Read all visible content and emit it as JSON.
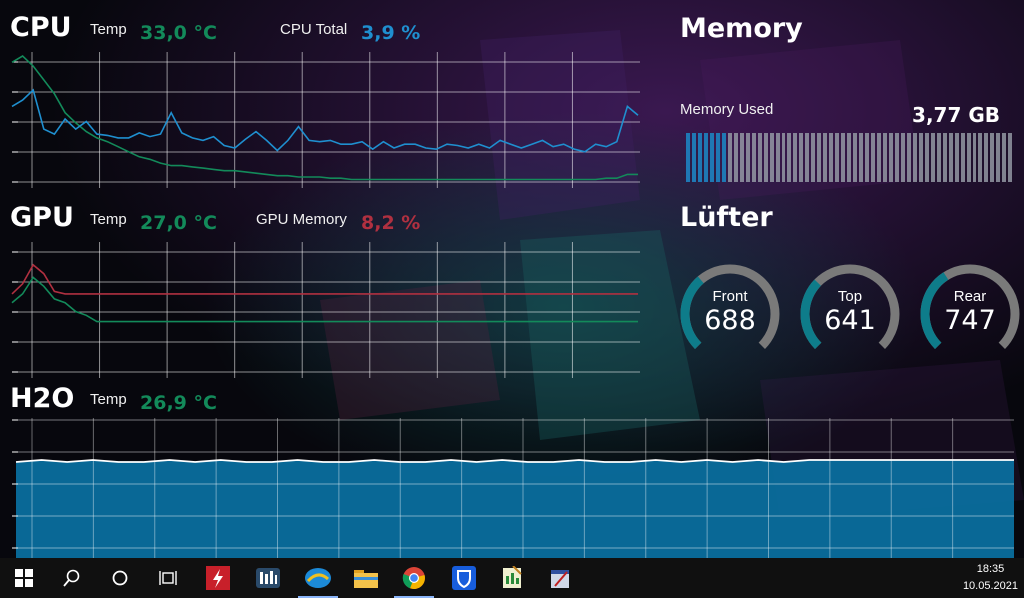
{
  "cpu": {
    "title": "CPU",
    "temp_label": "Temp",
    "temp_value": "33,0 °C",
    "total_label": "CPU Total",
    "total_value": "3,9 %",
    "colors": {
      "temp": "#138a5a",
      "total": "#1f8fcf"
    },
    "chart_data": {
      "type": "line",
      "series": [
        {
          "values": [
            95,
            100,
            92,
            81,
            70,
            55,
            47,
            40,
            35,
            32,
            28,
            24,
            20,
            18,
            15,
            13,
            13,
            12,
            11,
            10,
            9,
            9,
            8,
            7,
            6,
            5,
            5,
            4,
            4,
            4,
            3,
            3,
            2,
            2,
            2,
            2,
            2,
            2,
            2,
            2,
            2,
            2,
            2,
            2,
            2,
            2,
            2,
            2,
            2,
            2,
            2,
            2,
            2,
            2,
            2,
            2,
            3,
            3,
            6,
            6
          ]
        },
        {
          "values": [
            60,
            65,
            73,
            42,
            38,
            50,
            42,
            48,
            38,
            37,
            35,
            35,
            39,
            36,
            38,
            55,
            39,
            35,
            33,
            36,
            29,
            27,
            34,
            40,
            33,
            25,
            33,
            44,
            33,
            32,
            33,
            30,
            30,
            32,
            26,
            32,
            27,
            30,
            30,
            27,
            26,
            30,
            29,
            27,
            30,
            27,
            33,
            30,
            27,
            30,
            33,
            28,
            30,
            26,
            24,
            30,
            28,
            32,
            60,
            53
          ]
        }
      ],
      "ylim": [
        0,
        100
      ],
      "grid": true
    }
  },
  "gpu": {
    "title": "GPU",
    "temp_label": "Temp",
    "temp_value": "27,0 °C",
    "mem_label": "GPU Memory",
    "mem_value": "8,2 %",
    "colors": {
      "temp": "#138a5a",
      "mem": "#b03040"
    },
    "chart_data": {
      "type": "line",
      "series": [
        {
          "values": [
            55,
            62,
            75,
            68,
            58,
            55,
            48,
            45,
            40,
            40,
            40,
            40,
            40,
            40,
            40,
            40,
            40,
            40,
            40,
            40,
            40,
            40,
            40,
            40,
            40,
            40,
            40,
            40,
            40,
            40,
            40,
            40,
            40,
            40,
            40,
            40,
            40,
            40,
            40,
            40,
            40,
            40,
            40,
            40,
            40,
            40,
            40,
            40,
            40,
            40,
            40,
            40,
            40,
            40,
            40,
            40,
            40,
            40,
            40,
            40
          ]
        },
        {
          "values": [
            62,
            70,
            85,
            78,
            64,
            62,
            62,
            62,
            62,
            62,
            62,
            62,
            62,
            62,
            62,
            62,
            62,
            62,
            62,
            62,
            62,
            62,
            62,
            62,
            62,
            62,
            62,
            62,
            62,
            62,
            62,
            62,
            62,
            62,
            62,
            62,
            62,
            62,
            62,
            62,
            62,
            62,
            62,
            62,
            62,
            62,
            62,
            62,
            62,
            62,
            62,
            62,
            62,
            62,
            62,
            62,
            62,
            62,
            62,
            62
          ]
        }
      ],
      "ylim": [
        0,
        100
      ],
      "grid": true
    }
  },
  "h2o": {
    "title": "H2O",
    "temp_label": "Temp",
    "temp_value": "26,9 °C",
    "colors": {
      "temp": "#138a5a",
      "fill": "#0a6e9e"
    },
    "chart_data": {
      "type": "area",
      "series": [
        {
          "values": [
            49,
            50,
            49,
            50,
            49,
            49,
            50,
            49,
            50,
            49,
            49,
            50,
            49,
            49,
            50,
            49,
            49,
            50,
            49,
            50,
            49,
            49,
            50,
            49,
            49,
            50,
            49,
            50,
            49,
            50,
            49,
            50,
            50,
            50,
            50,
            50,
            50,
            50,
            50,
            50
          ]
        }
      ],
      "ylim": [
        0,
        100
      ],
      "grid": true
    }
  },
  "memory": {
    "title": "Memory",
    "used_label": "Memory Used",
    "used_value": "3,77 GB",
    "used_fraction": 0.12,
    "colors": {
      "used": "#1f78b4",
      "free": "#9aa0aa"
    }
  },
  "fans": {
    "title": "Lüfter",
    "items": [
      {
        "name": "Front",
        "value": "688",
        "fraction": 0.35
      },
      {
        "name": "Top",
        "value": "641",
        "fraction": 0.33
      },
      {
        "name": "Rear",
        "value": "747",
        "fraction": 0.38
      }
    ],
    "colors": {
      "arc": "#0e7c8a",
      "track": "#7a7a7a"
    }
  },
  "taskbar": {
    "items": [
      {
        "name": "start-button",
        "icon": "windows-logo-icon"
      },
      {
        "name": "search-button",
        "icon": "search-icon"
      },
      {
        "name": "cortana-button",
        "icon": "circle-icon"
      },
      {
        "name": "task-view-button",
        "icon": "task-view-icon"
      },
      {
        "name": "app-red-lightning",
        "icon": "lightning-app-icon"
      },
      {
        "name": "app-meter",
        "icon": "meter-app-icon"
      },
      {
        "name": "app-cloud-sync",
        "icon": "cloud-sync-icon"
      },
      {
        "name": "app-file-explorer",
        "icon": "folder-icon"
      },
      {
        "name": "app-chrome",
        "icon": "chrome-icon"
      },
      {
        "name": "app-bitwarden",
        "icon": "shield-icon"
      },
      {
        "name": "app-notepad",
        "icon": "notepad-icon"
      },
      {
        "name": "app-editor",
        "icon": "editor-icon"
      }
    ],
    "time": "18:35",
    "date": "10.05.2021"
  }
}
